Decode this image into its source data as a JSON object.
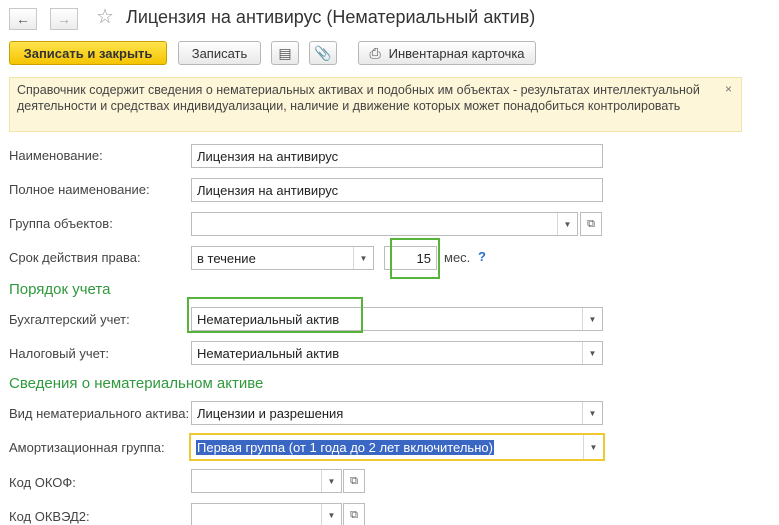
{
  "header": {
    "back_icon": "arrow-left-icon",
    "forward_icon": "arrow-right-icon",
    "favorite_icon": "star-icon",
    "title": "Лицензия на антивирус (Нематериальный актив)"
  },
  "toolbar": {
    "save_close_label": "Записать и закрыть",
    "save_label": "Записать",
    "report_icon": "document-list-icon",
    "attach_icon": "paperclip-icon",
    "print_icon": "printer-icon",
    "inventory_card_label": "Инвентарная карточка"
  },
  "banner": {
    "text": "Справочник содержит сведения о нематериальных активах и подобных им объектах - результатах интеллектуальной деятельности и средствах индивидуализации, наличие и движение которых может понадобиться контролировать",
    "close_glyph": "×"
  },
  "form": {
    "name_label": "Наименование:",
    "name_value": "Лицензия на антивирус",
    "full_name_label": "Полное наименование:",
    "full_name_value": "Лицензия на антивирус",
    "group_label": "Группа объектов:",
    "group_value": "",
    "term_label": "Срок действия права:",
    "term_type_value": "в течение",
    "term_months_value": "15",
    "term_unit": "мес.",
    "help_glyph": "?"
  },
  "accounting": {
    "section_title": "Порядок учета",
    "bu_label": "Бухгалтерский учет:",
    "bu_value": "Нематериальный актив",
    "nu_label": "Налоговый учет:",
    "nu_value": "Нематериальный актив"
  },
  "intangible": {
    "section_title": "Сведения о нематериальном активе",
    "kind_label": "Вид нематериального актива:",
    "kind_value": "Лицензии и разрешения",
    "amort_label": "Амортизационная группа:",
    "amort_value": "Первая группа (от 1 года до 2 лет включительно)",
    "okof_label": "Код ОКОФ:",
    "okof_value": "",
    "okved_label": "Код ОКВЭД2:",
    "okved_value": ""
  },
  "colors": {
    "accent_green": "#2f9a3c",
    "highlight_green": "#58b33c",
    "highlight_yellow": "#f2c832",
    "primary_button": "#f5c400"
  }
}
